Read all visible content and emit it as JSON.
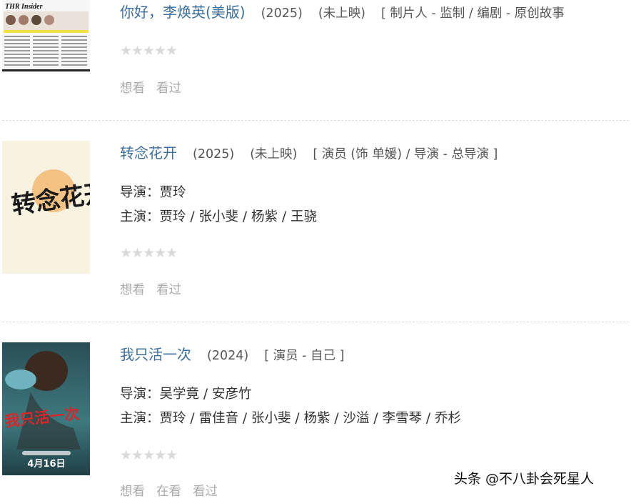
{
  "entries": [
    {
      "title": "你好，李焕英(美版)",
      "year": "(2025)",
      "status": "(未上映)",
      "roles": "[ 制片人 - 监制 / 编剧 - 原创故事",
      "poster_text": "THR Insider",
      "stars": "★★★★★",
      "actions": [
        "想看",
        "看过"
      ]
    },
    {
      "title": "转念花开",
      "year": "(2025)",
      "status": "(未上映)",
      "roles": "[ 演员 (饰 单媛) / 导演 - 总导演 ]",
      "director": "导演：贾玲",
      "cast": "主演：贾玲 / 张小斐 / 杨紫 / 王骁",
      "poster_text": "转念花开",
      "stars": "★★★★★",
      "actions": [
        "想看",
        "看过"
      ]
    },
    {
      "title": "我只活一次",
      "year": "(2024)",
      "roles": "[ 演员 - 自己 ]",
      "director": "导演：吴学竟 / 安彦竹",
      "cast": "主演：贾玲 / 雷佳音 / 张小斐 / 杨紫 / 沙溢 / 李雪琴 / 乔杉",
      "poster_text": "我只活一次",
      "poster_date": "4月16日",
      "stars": "★★★★★",
      "actions": [
        "想看",
        "在看",
        "看过"
      ]
    }
  ],
  "watermark": "头条 @不八卦会死星人"
}
